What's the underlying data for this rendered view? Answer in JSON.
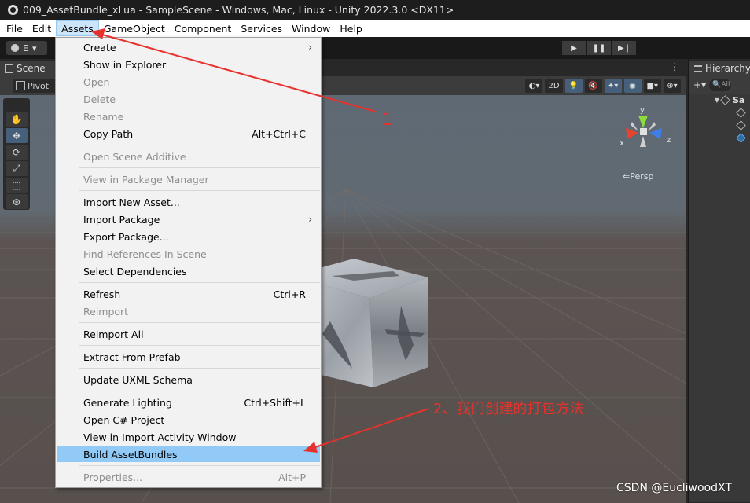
{
  "window": {
    "title": "009_AssetBundle_xLua - SampleScene - Windows, Mac, Linux - Unity 2022.3.0 <DX11>"
  },
  "menubar": {
    "items": [
      "File",
      "Edit",
      "Assets",
      "GameObject",
      "Component",
      "Services",
      "Window",
      "Help"
    ],
    "active": "Assets"
  },
  "toolbar": {
    "account_label": "E",
    "play_icons": [
      "play-icon",
      "pause-icon",
      "step-icon"
    ]
  },
  "scene": {
    "tab_label": "Scene",
    "panel_menu": "⋮",
    "pivot_label": "Pivot",
    "view_2d_label": "2D",
    "persp_label": "Persp",
    "gizmo": {
      "y": "y",
      "x": "x",
      "z": "z"
    },
    "tools": [
      "hand-tool",
      "move-tool",
      "rotate-tool",
      "scale-tool",
      "rect-tool",
      "transform-tool"
    ]
  },
  "hierarchy": {
    "tab_label": "Hierarchy",
    "add_label": "+",
    "search_placeholder": "All",
    "root_label": "Sa"
  },
  "assets_menu": {
    "items": [
      {
        "label": "Create",
        "shortcut": "",
        "submenu": true,
        "disabled": false
      },
      {
        "label": "Show in Explorer",
        "shortcut": "",
        "disabled": false
      },
      {
        "label": "Open",
        "shortcut": "",
        "disabled": true
      },
      {
        "label": "Delete",
        "shortcut": "",
        "disabled": true
      },
      {
        "label": "Rename",
        "shortcut": "",
        "disabled": true
      },
      {
        "label": "Copy Path",
        "shortcut": "Alt+Ctrl+C",
        "disabled": false
      },
      {
        "label": "Open Scene Additive",
        "shortcut": "",
        "disabled": true
      },
      {
        "label": "View in Package Manager",
        "shortcut": "",
        "disabled": true
      },
      {
        "label": "Import New Asset...",
        "shortcut": "",
        "disabled": false
      },
      {
        "label": "Import Package",
        "shortcut": "",
        "submenu": true,
        "disabled": false
      },
      {
        "label": "Export Package...",
        "shortcut": "",
        "disabled": false
      },
      {
        "label": "Find References In Scene",
        "shortcut": "",
        "disabled": true
      },
      {
        "label": "Select Dependencies",
        "shortcut": "",
        "disabled": false
      },
      {
        "label": "Refresh",
        "shortcut": "Ctrl+R",
        "disabled": false
      },
      {
        "label": "Reimport",
        "shortcut": "",
        "disabled": true
      },
      {
        "label": "Reimport All",
        "shortcut": "",
        "disabled": false
      },
      {
        "label": "Extract From Prefab",
        "shortcut": "",
        "disabled": false
      },
      {
        "label": "Update UXML Schema",
        "shortcut": "",
        "disabled": false
      },
      {
        "label": "Generate Lighting",
        "shortcut": "Ctrl+Shift+L",
        "disabled": false
      },
      {
        "label": "Open C# Project",
        "shortcut": "",
        "disabled": false
      },
      {
        "label": "View in Import Activity Window",
        "shortcut": "",
        "disabled": false
      },
      {
        "label": "Build AssetBundles",
        "shortcut": "",
        "disabled": false,
        "highlighted": true
      },
      {
        "label": "Properties...",
        "shortcut": "Alt+P",
        "disabled": true
      }
    ]
  },
  "annotations": {
    "label_1": "1",
    "label_2": "2、我们创建的打包方法",
    "color": "#e8312c"
  },
  "watermark": "CSDN @EucliwoodXT"
}
